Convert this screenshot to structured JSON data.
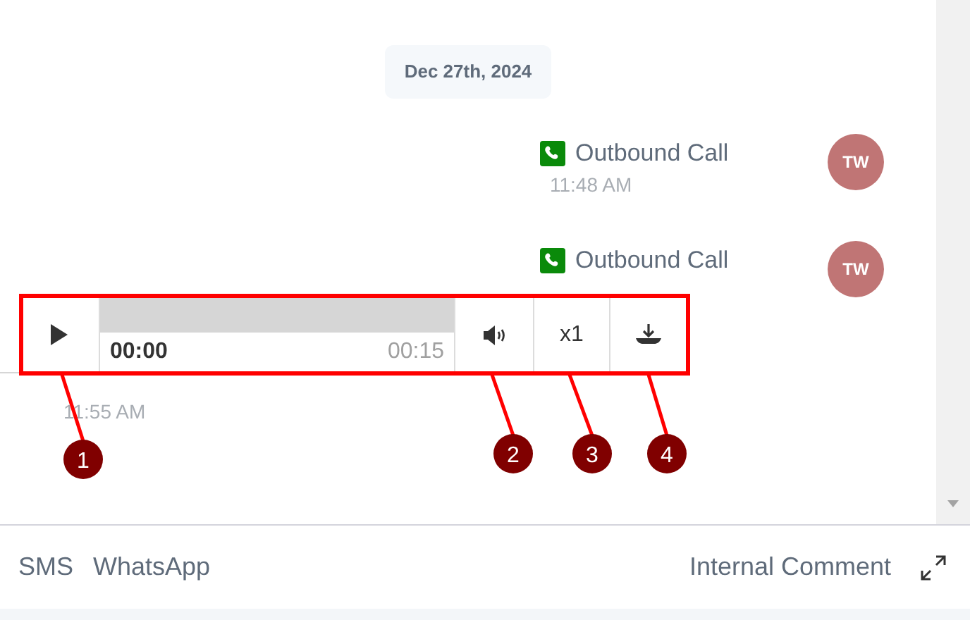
{
  "date_divider": "Dec 27th, 2024",
  "messages": [
    {
      "kind": "call",
      "title": "Outbound Call",
      "time": "11:48 AM",
      "avatar": "TW"
    },
    {
      "kind": "call",
      "title": "Outbound Call",
      "avatar": "TW"
    }
  ],
  "audio_player": {
    "elapsed": "00:00",
    "duration": "00:15",
    "speed": "x1",
    "time": "11:55 AM"
  },
  "callouts": [
    {
      "label": "1"
    },
    {
      "label": "2"
    },
    {
      "label": "3"
    },
    {
      "label": "4"
    }
  ],
  "composer_tabs": [
    {
      "label": "SMS"
    },
    {
      "label": "WhatsApp"
    },
    {
      "label": "Internal Comment"
    }
  ]
}
